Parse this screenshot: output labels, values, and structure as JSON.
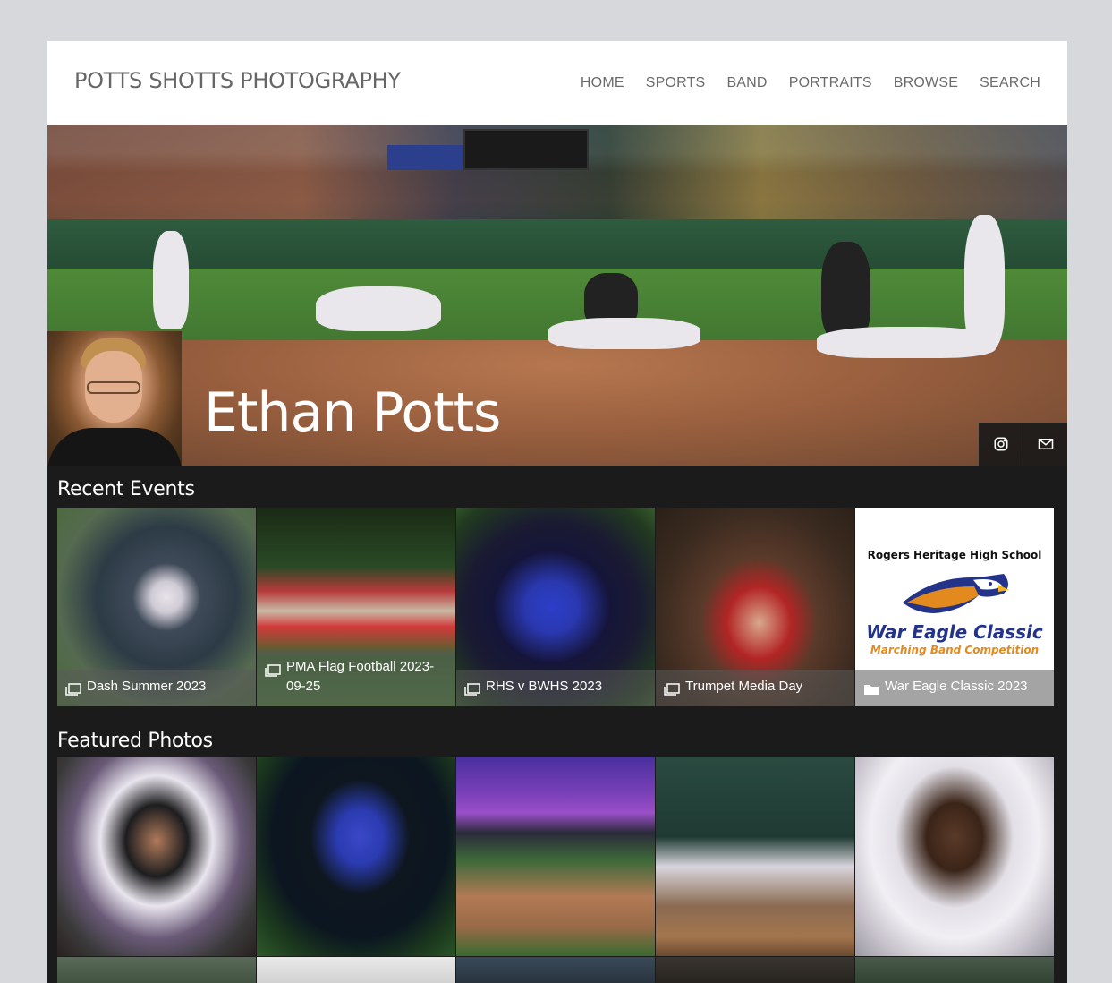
{
  "site": {
    "title": "POTTS SHOTTS PHOTOGRAPHY",
    "nav": [
      "HOME",
      "SPORTS",
      "BAND",
      "PORTRAITS",
      "BROWSE",
      "SEARCH"
    ]
  },
  "profile": {
    "name": "Ethan Potts",
    "social": [
      {
        "icon": "instagram-icon"
      },
      {
        "icon": "email-icon"
      }
    ]
  },
  "recent_events": {
    "title": "Recent Events",
    "items": [
      {
        "label": "Dash Summer 2023",
        "type": "gallery"
      },
      {
        "label": "PMA Flag Football 2023-09-25",
        "type": "gallery"
      },
      {
        "label": "RHS v BWHS 2023",
        "type": "gallery"
      },
      {
        "label": "Trumpet Media Day",
        "type": "gallery"
      },
      {
        "label": "War Eagle Classic 2023",
        "type": "folder"
      }
    ],
    "logo_text": {
      "school": "Rogers Heritage High School",
      "event": "War Eagle Classic",
      "subtitle": "Marching Band Competition"
    }
  },
  "featured": {
    "title": "Featured Photos"
  },
  "colors": {
    "page_bg": "#d7d8dc",
    "site_bg": "#1b1b1c",
    "header_bg": "#ffffff",
    "nav_text": "#6b6b6b",
    "logo_blue": "#23338a",
    "logo_orange": "#e38a1f"
  }
}
